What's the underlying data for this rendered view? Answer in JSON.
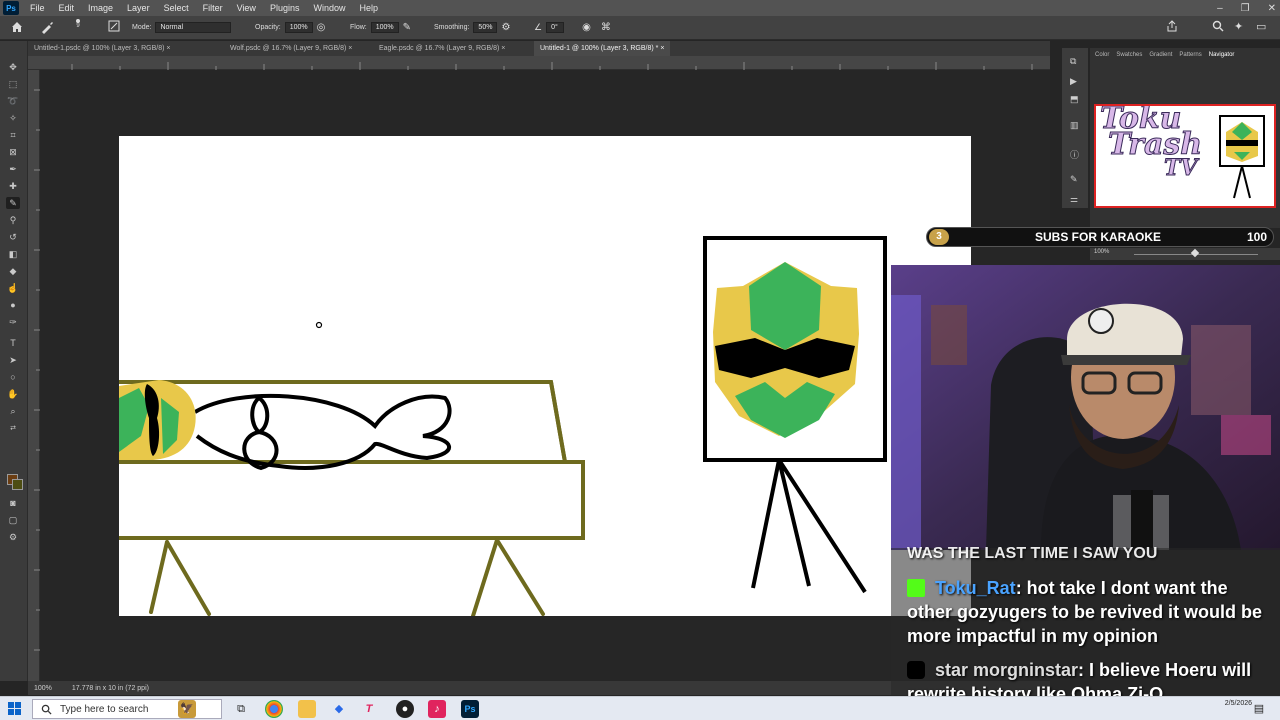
{
  "app": {
    "logo_text": "Ps"
  },
  "menu": [
    "File",
    "Edit",
    "Image",
    "Layer",
    "Select",
    "Filter",
    "View",
    "Plugins",
    "Window",
    "Help"
  ],
  "window_controls": [
    "–",
    "❐",
    "✕"
  ],
  "options_bar": {
    "mode_label": "Mode:",
    "mode_value": "Normal",
    "opacity_label": "Opacity:",
    "opacity_value": "100%",
    "flow_label": "Flow:",
    "flow_value": "100%",
    "smoothing_label": "Smoothing:",
    "smoothing_value": "50%",
    "angle_value": "0°",
    "brush_size": "9"
  },
  "tabs": [
    {
      "label": "Untitled-1.psdc @ 100% (Layer 3, RGB/8) ×",
      "active": false
    },
    {
      "label": "Wolf.psdc @ 16.7% (Layer 9, RGB/8) ×",
      "active": false
    },
    {
      "label": "Eagle.psdc @ 16.7% (Layer 9, RGB/8) ×",
      "active": false
    },
    {
      "label": "Untitled-1 @ 100% (Layer 3, RGB/8) * ×",
      "active": true
    }
  ],
  "status": {
    "zoom": "100%",
    "doc_size": "17.778 in x 10 in (72 ppi)"
  },
  "panel": {
    "tabs": [
      "Color",
      "Swatches",
      "Gradient",
      "Patterns",
      "Navigator"
    ],
    "active_tab": "Navigator",
    "nav_zoom": "100%",
    "nav_logo_text": [
      "Toku",
      "Trash",
      "TV"
    ]
  },
  "overlay": {
    "subs_count": "3",
    "subs_label": "SUBS FOR KARAOKE",
    "subs_goal": "100"
  },
  "chat": {
    "header_partial": "WAS THE LAST TIME I SAW YOU",
    "messages": [
      {
        "platform": "kick",
        "user": "Toku_Rat",
        "text": ": hot take I dont want the other gozyugers to be revived it would be more impactful in my opinion"
      },
      {
        "platform": "tiktok",
        "user": "star morgninstar",
        "text": ": I believe Hoeru will rewrite history like Ohma Zi-O"
      }
    ]
  },
  "taskbar": {
    "search_placeholder": "Type here to search",
    "time": "",
    "date": "2/5/2026"
  },
  "colors": {
    "accent_yellow": "#e8c84a",
    "mask_green": "#3cb35a",
    "ps_blue": "#31a8ff",
    "kick_green": "#53fc18"
  }
}
